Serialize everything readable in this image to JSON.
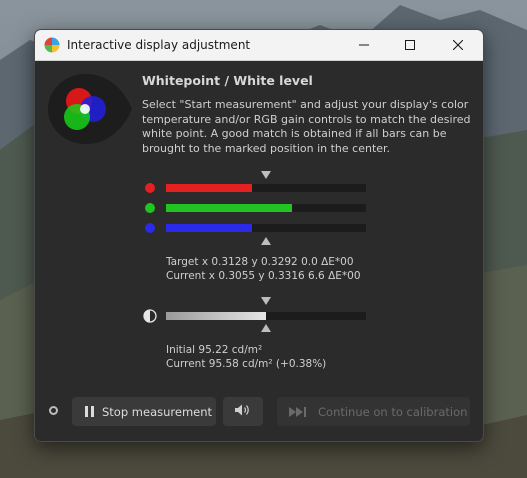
{
  "window": {
    "title": "Interactive display adjustment"
  },
  "content": {
    "heading": "Whitepoint / White level",
    "description": "Select \"Start measurement\" and adjust your display's color temperature and/or RGB gain controls to match the desired white point. A good match is obtained if all bars can be brought to the marked position in the center."
  },
  "rgb_bars": [
    {
      "channel": "red",
      "color": "#e32121",
      "level": 0.43
    },
    {
      "channel": "green",
      "color": "#21c421",
      "level": 0.63
    },
    {
      "channel": "blue",
      "color": "#2a2ae8",
      "level": 0.43
    }
  ],
  "whitepoint": {
    "target": "Target x 0.3128 y 0.3292 0.0 ΔE*00",
    "current": "Current x 0.3055 y 0.3316 6.6 ΔE*00"
  },
  "luminance_bar": {
    "level": 0.5,
    "color": "#e6e6e6"
  },
  "luminance": {
    "initial": "Initial 95.22 cd/m²",
    "current": "Current 95.58 cd/m² (+0.38%)"
  },
  "buttons": {
    "stop_label": "Stop measurement",
    "continue_label": "Continue on to calibration"
  },
  "icons": {
    "app": "displaycal-icon",
    "sound": "speaker-icon",
    "pause": "pause-icon",
    "skip": "skip-forward-icon"
  }
}
